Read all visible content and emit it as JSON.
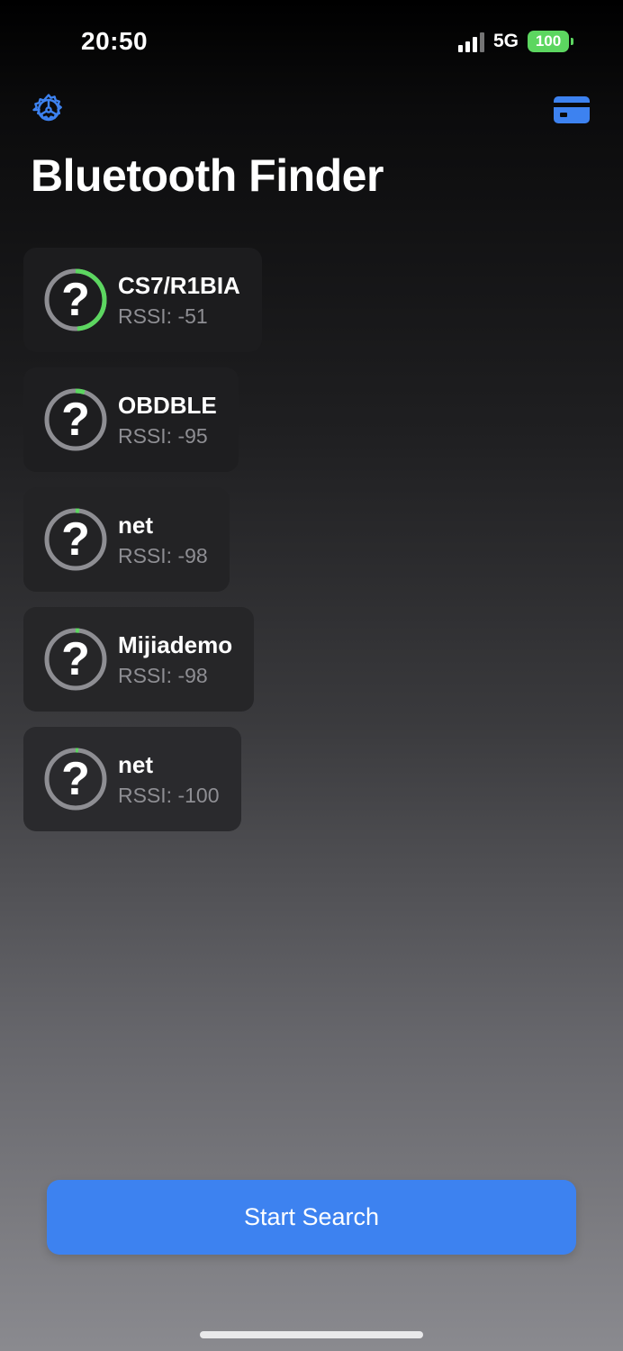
{
  "status_bar": {
    "time": "20:50",
    "network": "5G",
    "battery": "100",
    "battery_color": "#5cd660"
  },
  "header": {
    "settings_icon": "gear-icon",
    "card_icon": "credit-card-icon",
    "title": "Bluetooth Finder",
    "accent_color": "#3d82f0"
  },
  "devices": [
    {
      "name": "CS7/R1BIA",
      "rssi_label": "RSSI: -51",
      "rssi": -51,
      "signal_fraction": 0.49,
      "icon": "question-mark-icon"
    },
    {
      "name": "OBDBLE",
      "rssi_label": "RSSI: -95",
      "rssi": -95,
      "signal_fraction": 0.05,
      "icon": "question-mark-icon"
    },
    {
      "name": "net",
      "rssi_label": "RSSI: -98",
      "rssi": -98,
      "signal_fraction": 0.02,
      "icon": "question-mark-icon"
    },
    {
      "name": "Mijiademo",
      "rssi_label": "RSSI: -98",
      "rssi": -98,
      "signal_fraction": 0.02,
      "icon": "question-mark-icon"
    },
    {
      "name": "net",
      "rssi_label": "RSSI: -100",
      "rssi": -100,
      "signal_fraction": 0.01,
      "icon": "question-mark-icon"
    }
  ],
  "ring_colors": {
    "track": "#8e8e93",
    "progress": "#5cd660"
  },
  "actions": {
    "start_search_label": "Start Search"
  }
}
